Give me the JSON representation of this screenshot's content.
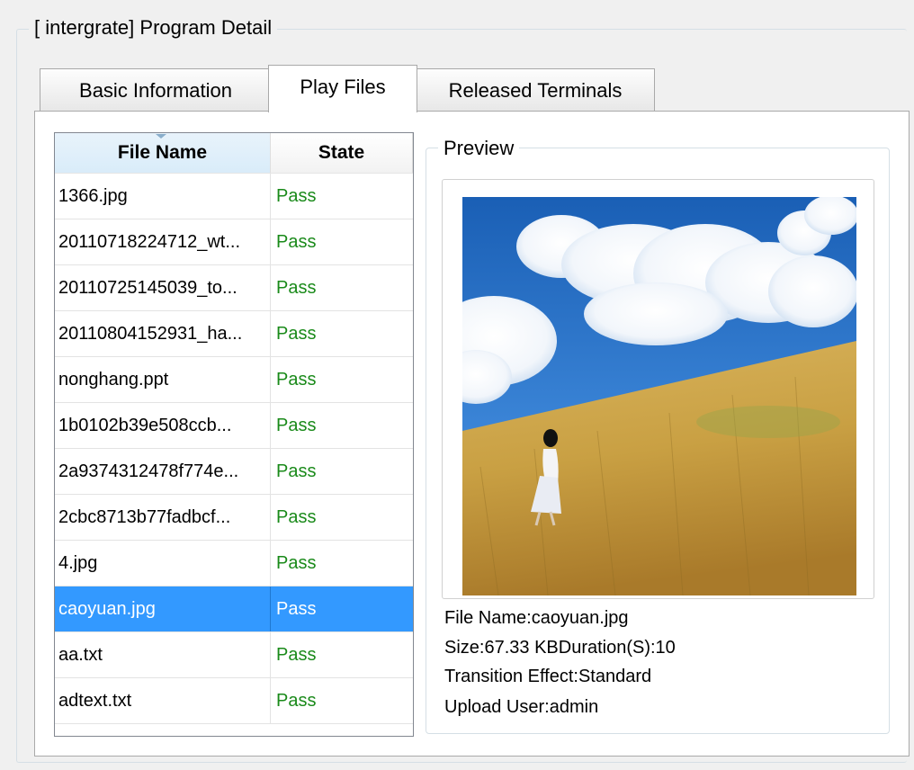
{
  "window": {
    "title": "[ intergrate] Program Detail"
  },
  "tabs": [
    {
      "label": "Basic Information"
    },
    {
      "label": "Play Files"
    },
    {
      "label": "Released Terminals"
    }
  ],
  "grid": {
    "columns": [
      "File Name",
      "State"
    ],
    "rows": [
      {
        "name": "1366.jpg",
        "state": "Pass"
      },
      {
        "name": "20110718224712_wt...",
        "state": "Pass"
      },
      {
        "name": "20110725145039_to...",
        "state": "Pass"
      },
      {
        "name": "20110804152931_ha...",
        "state": "Pass"
      },
      {
        "name": "nonghang.ppt",
        "state": "Pass"
      },
      {
        "name": "1b0102b39e508ccb...",
        "state": "Pass"
      },
      {
        "name": "2a9374312478f774e...",
        "state": "Pass"
      },
      {
        "name": "2cbc8713b77fadbcf...",
        "state": "Pass"
      },
      {
        "name": "4.jpg",
        "state": "Pass"
      },
      {
        "name": "caoyuan.jpg",
        "state": "Pass"
      },
      {
        "name": "aa.txt",
        "state": "Pass"
      },
      {
        "name": "adtext.txt",
        "state": "Pass"
      }
    ]
  },
  "preview": {
    "title": "Preview",
    "info": [
      "File Name:caoyuan.jpg",
      "Size:67.33 KBDuration(S):10",
      "Transition Effect:Standard",
      "Upload User:admin"
    ]
  }
}
